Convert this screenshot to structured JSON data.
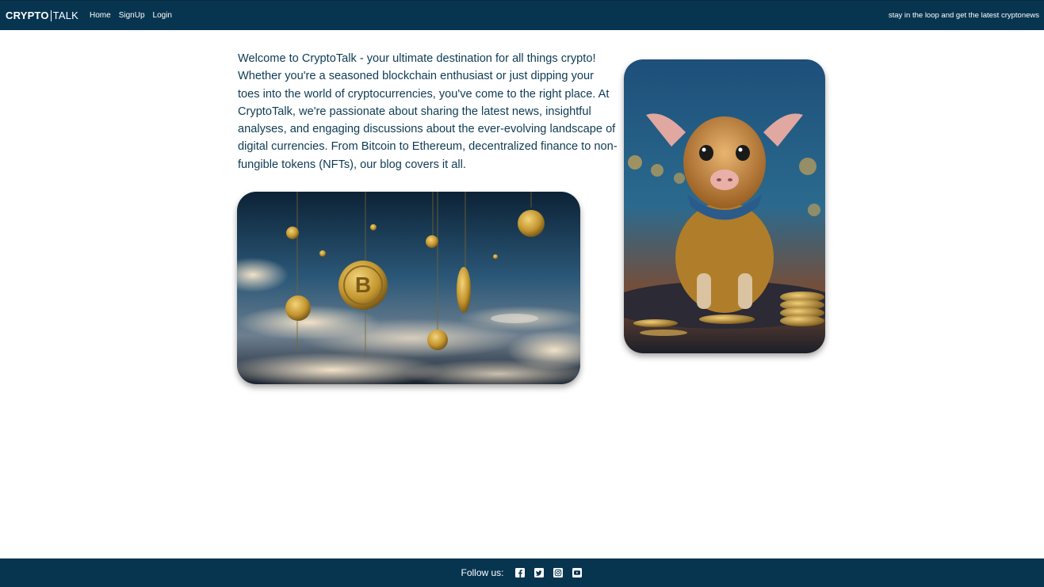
{
  "header": {
    "brand_bold": "CRYPTO",
    "brand_light": "TALK",
    "nav": {
      "home": "Home",
      "signup": "SignUp",
      "login": "Login"
    },
    "tagline": "stay in the loop and get the latest cryptonews"
  },
  "main": {
    "intro_text": "Welcome to CryptoTalk - your ultimate destination for all things crypto! Whether you're a seasoned blockchain enthusiast or just dipping your toes into the world of cryptocurrencies, you've come to the right place. At CryptoTalk, we're passionate about sharing the latest news, insightful analyses, and engaging discussions about the ever-evolving landscape of digital currencies. From Bitcoin to Ethereum, decentralized finance to non-fungible tokens (NFTs), our blog covers it all."
  },
  "footer": {
    "follow_label": "Follow us:",
    "social": [
      "facebook-icon",
      "twitter-icon",
      "instagram-icon",
      "youtube-icon"
    ]
  },
  "colors": {
    "nav_bg": "#073550",
    "text": "#0d3b53"
  }
}
